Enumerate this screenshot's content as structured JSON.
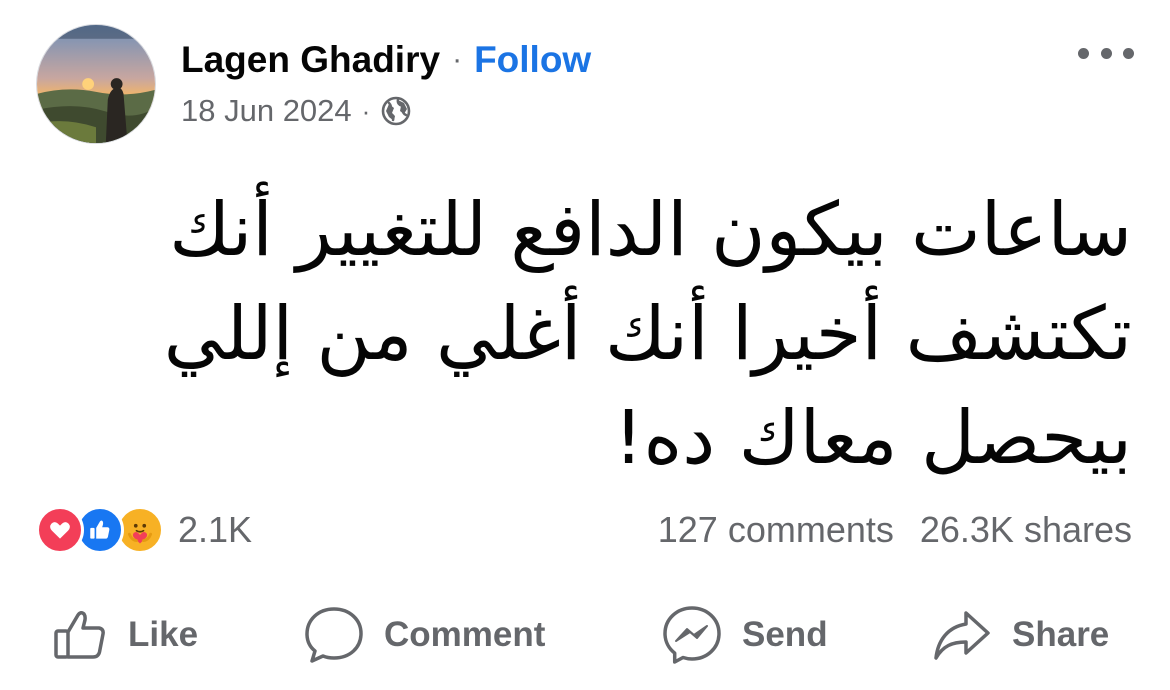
{
  "author": {
    "name": "Lagen Ghadiry",
    "separator": "·",
    "follow_label": "Follow"
  },
  "meta": {
    "date": "18 Jun 2024",
    "separator": "·",
    "privacy_icon": "globe-icon"
  },
  "post": {
    "text": "ساعات بيكون الدافع للتغيير أنك تكتشف أخيرا أنك أغلي من إللي بيحصل معاك ده!"
  },
  "reactions": {
    "types": [
      "love",
      "like",
      "care"
    ],
    "count": "2.1K"
  },
  "stats": {
    "comments": "127 comments",
    "shares": "26.3K shares"
  },
  "actions": {
    "like": "Like",
    "comment": "Comment",
    "send": "Send",
    "share": "Share"
  },
  "colors": {
    "link": "#1b74e4",
    "secondary_text": "#65676b",
    "love": "#f33e58",
    "like": "#1877f2",
    "care": "#f7b125"
  }
}
